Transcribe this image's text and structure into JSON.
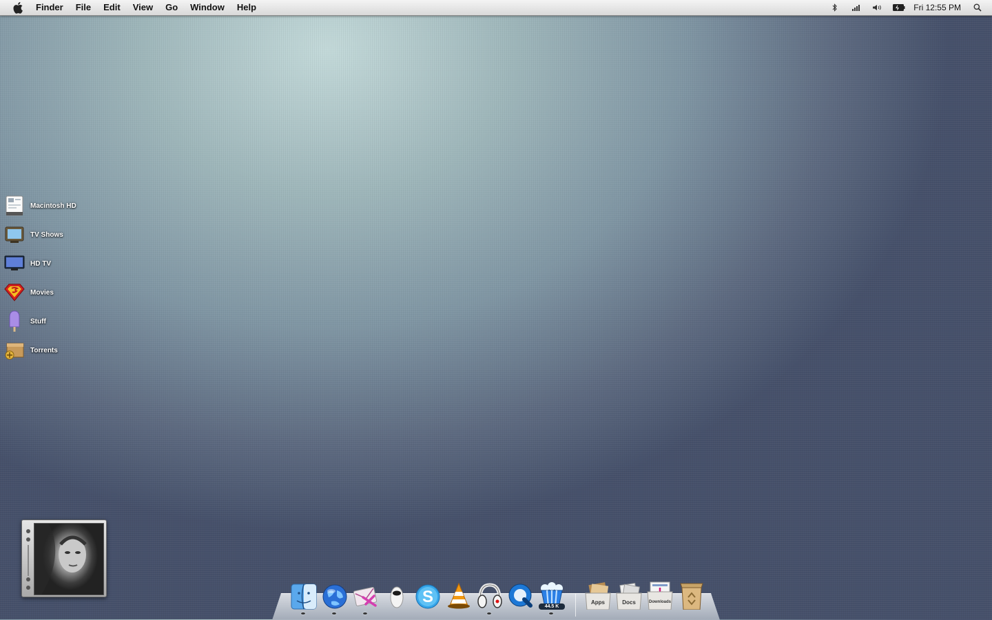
{
  "menubar": {
    "app_name": "Finder",
    "menus": [
      "File",
      "Edit",
      "View",
      "Go",
      "Window",
      "Help"
    ],
    "clock": "Fri 12:55 PM",
    "status_icons": [
      "bluetooth-icon",
      "signal-icon",
      "volume-icon",
      "battery-icon",
      "spotlight-icon"
    ]
  },
  "desktop": {
    "items": [
      {
        "label": "Macintosh HD",
        "icon": "hard-drive-icon"
      },
      {
        "label": "TV Shows",
        "icon": "tv-icon"
      },
      {
        "label": "HD TV",
        "icon": "monitor-icon"
      },
      {
        "label": "Movies",
        "icon": "superman-icon"
      },
      {
        "label": "Stuff",
        "icon": "popsicle-icon"
      },
      {
        "label": "Torrents",
        "icon": "box-icon"
      }
    ]
  },
  "dock": {
    "apps": [
      "finder-icon",
      "globe-icon",
      "mail-icon",
      "robot-icon",
      "skype-icon",
      "vlc-icon",
      "headphones-icon",
      "quicktime-icon",
      "popcorn-icon"
    ],
    "popcorn_badge": "44.5 K",
    "stacks": [
      {
        "label": "Apps"
      },
      {
        "label": "Docs"
      },
      {
        "label": "Downloads"
      }
    ],
    "trash": "trash-icon"
  },
  "colors": {
    "menubar_top": "#f4f4f4",
    "menubar_bottom": "#d9d9d9",
    "desktop_light": "#c3d9d9",
    "desktop_dark": "#45506a"
  }
}
